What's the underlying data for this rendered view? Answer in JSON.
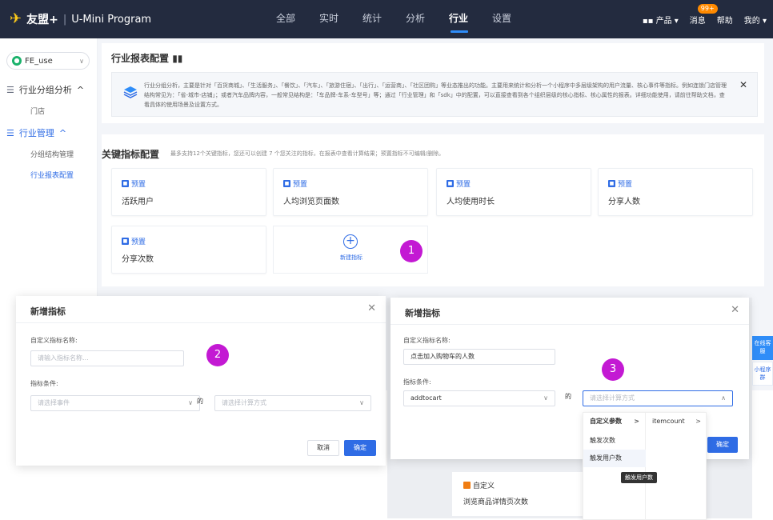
{
  "topbar": {
    "brand": "友盟+",
    "product": "U-Mini Program",
    "nav": [
      "全部",
      "实时",
      "统计",
      "分析",
      "行业",
      "设置"
    ],
    "active_nav": "行业",
    "right": {
      "products": "产品",
      "messages": "消息",
      "badge": "99+",
      "help": "帮助",
      "mine": "我的"
    }
  },
  "sidebar": {
    "app": "FE_use",
    "groups": [
      {
        "label": "行业分组分析",
        "items": [
          "门店"
        ]
      },
      {
        "label": "行业管理",
        "items": [
          "分组结构管理",
          "行业报表配置"
        ]
      }
    ],
    "active_item": "行业报表配置"
  },
  "report_card": {
    "title": "行业报表配置",
    "notice": "行业分组分析，主要是针对「百货商城」、「生活服务」、「餐饮」、「汽车」、「旅游住宿」、「出行」、「运营商」、「社区团购」等业态推出的功能。主要用来统计和分析一个小程序中多层级架构的用户流量、核心事件等指标。例如连锁门店管理结构常见为：「省-城市-店铺」；或者汽车品牌内容，一般常见结构是：「车品牌-车系-车型号」等；通过「行业管理」和「sdk」中的配置，可以直接查看到各个组织层级的核心指标、核心属性的报表。详细功能使用，请前往帮助文档，查看具体的使用场景及设置方式。"
  },
  "metrics_card": {
    "title": "关键指标配置",
    "subtitle": "最多支持12个关键指标，您还可以创建 7 个您关注的指标，在报表中查看计算结果；预置指标不可编辑/删除。",
    "metrics": [
      {
        "tag": "预置",
        "name": "活跃用户"
      },
      {
        "tag": "预置",
        "name": "人均浏览页面数"
      },
      {
        "tag": "预置",
        "name": "人均使用时长"
      },
      {
        "tag": "预置",
        "name": "分享人数"
      },
      {
        "tag": "预置",
        "name": "分享次数"
      }
    ],
    "add_label": "新建指标"
  },
  "steps": [
    "1",
    "2",
    "3"
  ],
  "dialog1": {
    "title": "新增指标",
    "name_label": "自定义指标名称:",
    "name_placeholder": "请输入指标名称...",
    "cond_label": "指标条件:",
    "event_placeholder": "请选择事件",
    "de": "的",
    "calc_placeholder": "请选择计算方式",
    "cancel": "取消",
    "ok": "确定"
  },
  "dialog2": {
    "title": "新增指标",
    "name_label": "自定义指标名称:",
    "name_value": "点击加入购物车的人数",
    "cond_label": "指标条件:",
    "event_value": "addtocart",
    "de": "的",
    "calc_placeholder": "请选择计算方式",
    "ok": "确定"
  },
  "dropdown": {
    "col1": [
      "自定义参数",
      "触发次数",
      "触发用户数"
    ],
    "col2": [
      "itemcount"
    ],
    "tooltip": "触发用户数"
  },
  "custom_card": {
    "tag": "自定义",
    "name": "浏览商品详情页次数"
  },
  "float": {
    "help": "在线客服",
    "group": "小程序群"
  }
}
